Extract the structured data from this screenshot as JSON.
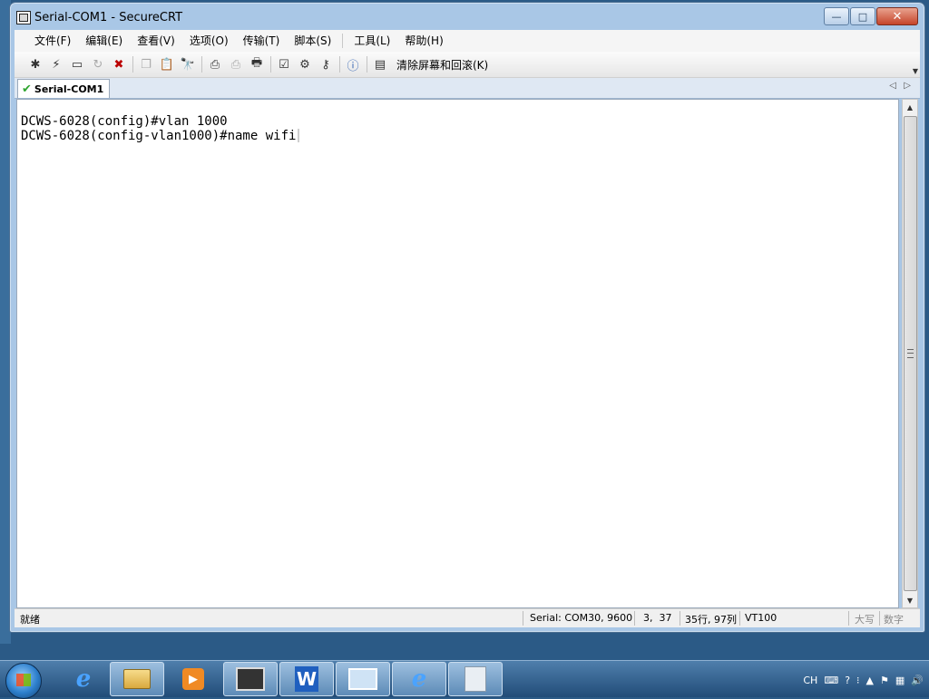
{
  "window": {
    "title": "Serial-COM1 - SecureCRT",
    "buttons": {
      "minimize": "—",
      "maximize": "□",
      "close": "✕"
    }
  },
  "menu": {
    "items": [
      "文件(F)",
      "编辑(E)",
      "查看(V)",
      "选项(O)",
      "传输(T)",
      "脚本(S)",
      "工具(L)",
      "帮助(H)"
    ]
  },
  "toolbar": {
    "clear_label": "清除屏幕和回滚(K)",
    "icons": [
      "connect-icon",
      "quick-connect-icon",
      "connect-tab-icon",
      "reconnect-icon",
      "disconnect-icon",
      "copy-icon",
      "paste-icon",
      "find-icon",
      "print-screen-icon",
      "print-selection-icon",
      "print-icon",
      "session-options-icon",
      "global-options-icon",
      "keymap-icon",
      "help-icon",
      "clear-screen-icon"
    ]
  },
  "tab": {
    "label": "Serial-COM1"
  },
  "terminal": {
    "lines": [
      "DCWS-6028(config)#vlan 1000",
      "DCWS-6028(config-vlan1000)#name wifi"
    ]
  },
  "status": {
    "ready": "就绪",
    "connection": "Serial: COM30, 9600",
    "cursor": "3,  37",
    "size": "35行, 97列",
    "emulation": "VT100",
    "caps": "大写",
    "num": "数字"
  },
  "taskbar": {
    "apps": [
      "start-button",
      "internet-explorer-icon",
      "file-explorer-icon",
      "media-player-icon",
      "securecrt-icon",
      "wps-writer-icon",
      "remote-desktop-icon",
      "internet-explorer-icon",
      "document-icon"
    ],
    "tray_lang": "CH"
  },
  "colors": {
    "window_frame": "#a9c7e6",
    "taskbar": "#2b5a86",
    "terminal_bg": "#ffffff"
  }
}
